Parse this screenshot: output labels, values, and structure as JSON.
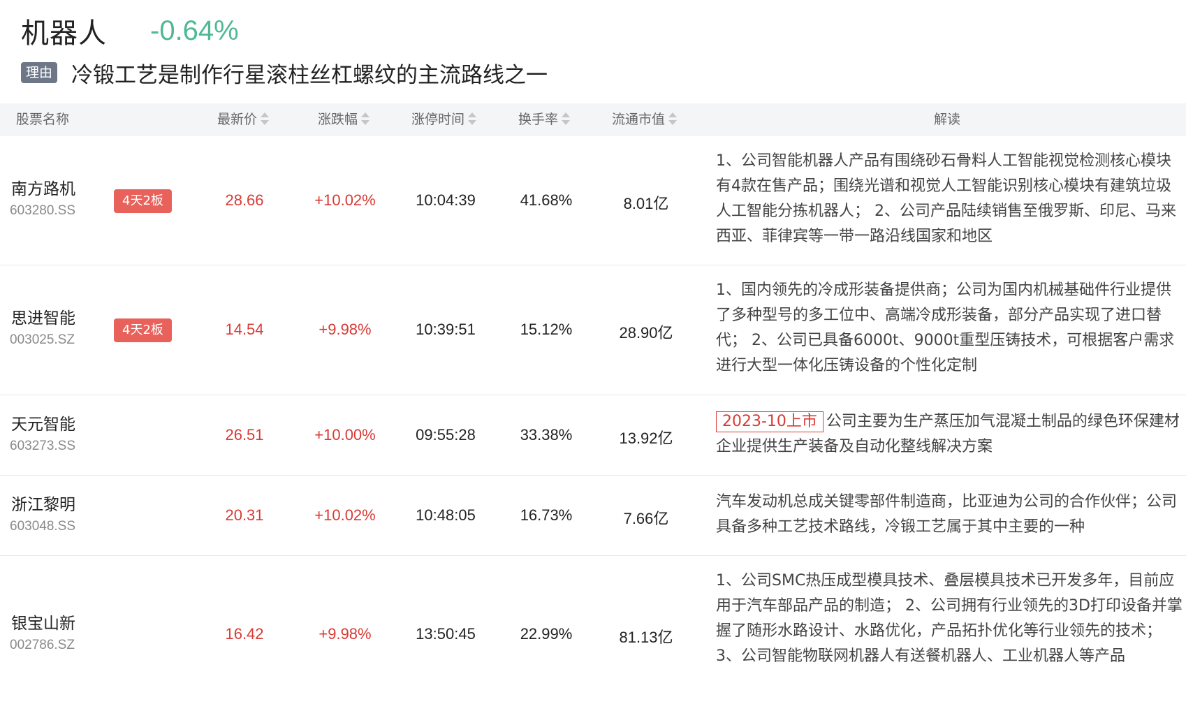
{
  "header": {
    "title": "机器人",
    "change": "-0.64%",
    "reason_tag": "理由",
    "reason_text": "冷锻工艺是制作行星滚柱丝杠螺纹的主流路线之一"
  },
  "colors": {
    "change_down": "#4fb896",
    "price_up": "#d93a35",
    "badge_bg": "#e8615a",
    "reason_tag_bg": "#6e7788",
    "header_bg": "#f4f5f7"
  },
  "table": {
    "columns": {
      "name": "股票名称",
      "price": "最新价",
      "change": "涨跌幅",
      "limit_time": "涨停时间",
      "turnover": "换手率",
      "float_cap": "流通市值",
      "analysis": "解读"
    },
    "rows": [
      {
        "name": "南方路机",
        "code": "603280.SS",
        "badge": "4天2板",
        "price": "28.66",
        "change": "+10.02%",
        "limit_time": "10:04:39",
        "turnover": "41.68%",
        "float_cap": "8.01亿",
        "tag": "",
        "analysis": "1、公司智能机器人产品有围绕砂石骨料人工智能视觉检测核心模块有4款在售产品；围绕光谱和视觉人工智能识别核心模块有建筑垃圾人工智能分拣机器人； 2、公司产品陆续销售至俄罗斯、印尼、马来西亚、菲律宾等一带一路沿线国家和地区"
      },
      {
        "name": "思进智能",
        "code": "003025.SZ",
        "badge": "4天2板",
        "price": "14.54",
        "change": "+9.98%",
        "limit_time": "10:39:51",
        "turnover": "15.12%",
        "float_cap": "28.90亿",
        "tag": "",
        "analysis": "1、国内领先的冷成形装备提供商；公司为国内机械基础件行业提供了多种型号的多工位中、高端冷成形装备，部分产品实现了进口替代； 2、公司已具备6000t、9000t重型压铸技术，可根据客户需求进行大型一体化压铸设备的个性化定制"
      },
      {
        "name": "天元智能",
        "code": "603273.SS",
        "badge": "",
        "price": "26.51",
        "change": "+10.00%",
        "limit_time": "09:55:28",
        "turnover": "33.38%",
        "float_cap": "13.92亿",
        "tag": "2023-10上市",
        "analysis": "公司主要为生产蒸压加气混凝土制品的绿色环保建材企业提供生产装备及自动化整线解决方案"
      },
      {
        "name": "浙江黎明",
        "code": "603048.SS",
        "badge": "",
        "price": "20.31",
        "change": "+10.02%",
        "limit_time": "10:48:05",
        "turnover": "16.73%",
        "float_cap": "7.66亿",
        "tag": "",
        "analysis": "汽车发动机总成关键零部件制造商，比亚迪为公司的合作伙伴；公司具备多种工艺技术路线，冷锻工艺属于其中主要的一种"
      },
      {
        "name": "银宝山新",
        "code": "002786.SZ",
        "badge": "",
        "price": "16.42",
        "change": "+9.98%",
        "limit_time": "13:50:45",
        "turnover": "22.99%",
        "float_cap": "81.13亿",
        "tag": "",
        "analysis": "1、公司SMC热压成型模具技术、叠层模具技术已开发多年，目前应用于汽车部品产品的制造； 2、公司拥有行业领先的3D打印设备并掌握了随形水路设计、水路优化，产品拓扑优化等行业领先的技术； 3、公司智能物联网机器人有送餐机器人、工业机器人等产品"
      }
    ]
  }
}
